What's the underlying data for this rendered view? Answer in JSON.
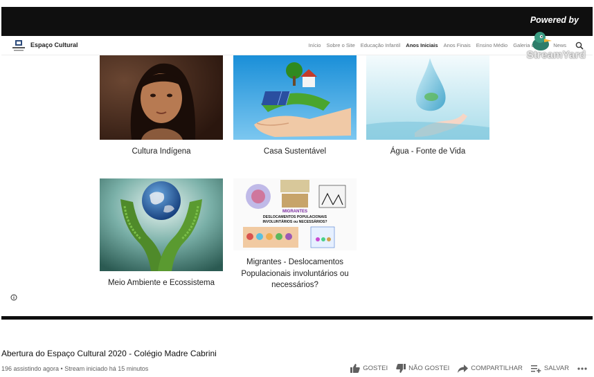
{
  "video": {
    "watermark": {
      "powered_by": "Powered by",
      "brand": "StreamYard"
    },
    "site": {
      "title": "Espaço Cultural",
      "nav": [
        {
          "label": "Início",
          "active": false
        },
        {
          "label": "Sobre o Site",
          "active": false
        },
        {
          "label": "Educação Infantil",
          "active": false
        },
        {
          "label": "Anos Iniciais",
          "active": true
        },
        {
          "label": "Anos Finais",
          "active": false
        },
        {
          "label": "Ensino Médio",
          "active": false
        },
        {
          "label": "Galeria de Arte",
          "active": false
        },
        {
          "label": "News",
          "active": false
        }
      ],
      "cards": [
        {
          "caption": "Cultura Indígena",
          "image_icon": "girl-portrait"
        },
        {
          "caption": "Casa Sustentável",
          "image_icon": "eco-house-in-hands"
        },
        {
          "caption": "Água - Fonte de Vida",
          "image_icon": "water-drop-hand"
        },
        {
          "caption": "Meio Ambiente e Ecossistema",
          "image_icon": "globe-in-leaf-hands"
        },
        {
          "caption": "Migrantes - Deslocamentos Populacionais involuntários ou necessários?",
          "image_icon": "migrants-collage",
          "image_text": {
            "heading": "MIGRANTES",
            "line1": "DESLOCAMENTOS POPULACIONAIS",
            "line2": "INVOLUNTÁRIOS ou NECESSÁRIOS?"
          }
        }
      ]
    }
  },
  "title": "Abertura do Espaço Cultural 2020 - Colégio Madre Cabrini",
  "meta": "196 assistindo agora • Stream iniciado há 15 minutos",
  "actions": {
    "like": "GOSTEI",
    "dislike": "NÃO GOSTEI",
    "share": "COMPARTILHAR",
    "save": "SALVAR"
  }
}
